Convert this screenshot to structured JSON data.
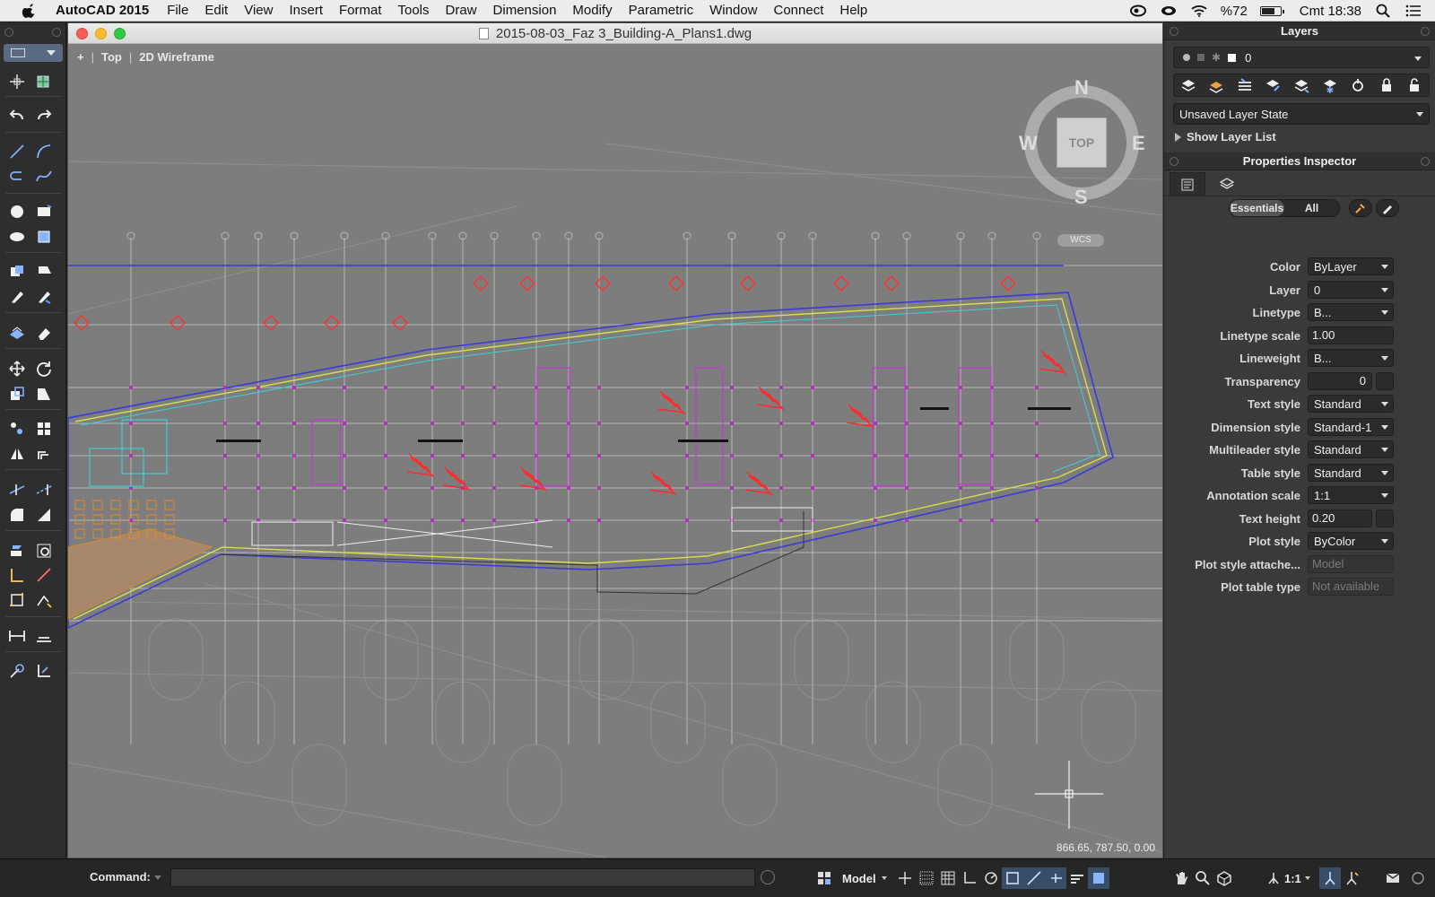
{
  "menubar": {
    "app_name": "AutoCAD 2015",
    "items": [
      "File",
      "Edit",
      "View",
      "Insert",
      "Format",
      "Tools",
      "Draw",
      "Dimension",
      "Modify",
      "Parametric",
      "Window",
      "Connect",
      "Help"
    ],
    "battery_text": "%72",
    "battery_level": 0.72,
    "clock": "Cmt 18:38"
  },
  "window": {
    "title": "2015-08-03_Faz 3_Building-A_Plans1.dwg"
  },
  "viewport": {
    "plus": "+",
    "view_name": "Top",
    "visual_style": "2D Wireframe",
    "coordinates": "866.65, 787.50, 0.00"
  },
  "viewcube": {
    "face": "TOP",
    "north": "N",
    "south": "S",
    "east": "E",
    "west": "W",
    "ucs": "WCS"
  },
  "layers_panel": {
    "title": "Layers",
    "current_layer": "0",
    "layer_state": "Unsaved Layer State",
    "show_layer_list": "Show Layer List"
  },
  "properties": {
    "title": "Properties Inspector",
    "tab_essentials": "Essentials",
    "tab_all": "All",
    "rows": [
      {
        "label": "Color",
        "value": "ByLayer",
        "kind": "dropdown"
      },
      {
        "label": "Layer",
        "value": "0",
        "kind": "dropdown"
      },
      {
        "label": "Linetype",
        "value": "B...",
        "kind": "dropdown"
      },
      {
        "label": "Linetype scale",
        "value": "1.00",
        "kind": "text"
      },
      {
        "label": "Lineweight",
        "value": "B...",
        "kind": "dropdown"
      },
      {
        "label": "Transparency",
        "value": "0",
        "kind": "text"
      },
      {
        "label": "Text style",
        "value": "Standard",
        "kind": "dropdown"
      },
      {
        "label": "Dimension style",
        "value": "Standard-1",
        "kind": "dropdown"
      },
      {
        "label": "Multileader style",
        "value": "Standard",
        "kind": "dropdown"
      },
      {
        "label": "Table style",
        "value": "Standard",
        "kind": "dropdown"
      },
      {
        "label": "Annotation scale",
        "value": "1:1",
        "kind": "dropdown"
      },
      {
        "label": "Text height",
        "value": "0.20",
        "kind": "text"
      },
      {
        "label": "Plot style",
        "value": "ByColor",
        "kind": "dropdown"
      },
      {
        "label": "Plot style attache...",
        "value": "Model",
        "kind": "disabled"
      },
      {
        "label": "Plot table type",
        "value": "Not available",
        "kind": "disabled"
      }
    ]
  },
  "statusbar": {
    "command_label": "Command:",
    "model": "Model",
    "annotation_scale": "1:1"
  },
  "colors": {
    "accent": "#3b7dd8",
    "drawing_bg": "#7d7d7d",
    "panel_bg": "#3a3a3a"
  }
}
